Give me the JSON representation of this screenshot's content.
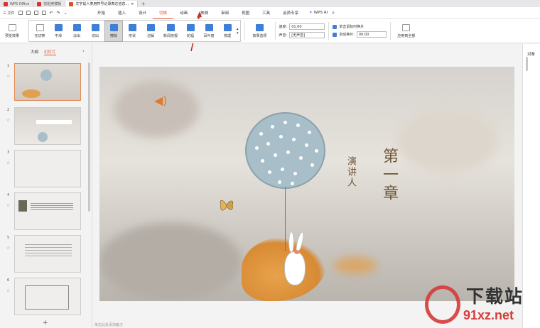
{
  "titlebar": {
    "tabs": [
      "WPS Office",
      "找稻壳模板",
      "文字是人类用符号记录表达信息..."
    ]
  },
  "menubar": {
    "file": "三 文件",
    "tabs": [
      "开始",
      "插入",
      "设计",
      "切换",
      "动画",
      "放映",
      "审阅",
      "视图",
      "工具",
      "会员专享"
    ],
    "active_tab": "切换",
    "wps_ai": "WPS AI"
  },
  "ribbon": {
    "preview": "预览效果",
    "effects": [
      "无切换",
      "平滑",
      "淡出",
      "切出",
      "擦除",
      "形状",
      "溶解",
      "新闻快报",
      "轮辐",
      "百叶窗",
      "梳理"
    ],
    "selected_effect": "擦除",
    "effect_options": "效果选项",
    "speed_label": "速度:",
    "speed_value": "01.00",
    "sound_label": "声音:",
    "sound_value": "[无声音]",
    "on_click": "单击鼠标时换片",
    "auto": "自动换片:",
    "auto_value": "00:00",
    "apply_all": "应用到全部"
  },
  "leftpanel": {
    "tabs": [
      "大纲",
      "幻灯片"
    ],
    "active_tab": "幻灯片",
    "slide_numbers": [
      "1",
      "2",
      "3",
      "4",
      "5",
      "6"
    ]
  },
  "slide": {
    "chapter": "第一章",
    "speaker": "演讲人"
  },
  "notes": {
    "placeholder": "单击此处添加备注"
  },
  "rightbar": {
    "label": "对象"
  },
  "watermark": {
    "text": "下载站",
    "url": "91xz.net"
  }
}
